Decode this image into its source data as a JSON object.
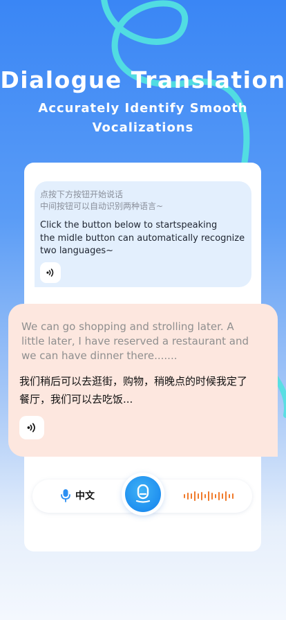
{
  "hero": {
    "title": "Dialogue Translation",
    "subtitle": "Accurately Identify Smooth Vocalizations"
  },
  "source_bubble": {
    "hint_line1": "点按下方按钮开始说话",
    "hint_line2": "中间按钮可以自动识别两种语言~",
    "text_line1": "Click the button below to startspeaking",
    "text_line2": "the midle button can automatically recognize",
    "text_line3": "two languages~",
    "speaker_icon": "speaker-icon"
  },
  "translation_bubble": {
    "en_line1": "We can go shopping and strolling later. A",
    "en_line2": "little later, I have reserved a restaurant and",
    "en_line3": "we can have dinner there.......",
    "zh_line1": "我们稍后可以去逛街，购物，稍晚点的时候我定了",
    "zh_line2": "餐厅，我们可以去吃饭...",
    "speaker_icon": "speaker-icon"
  },
  "controls": {
    "language_label": "中文",
    "language_icon": "microphone-icon",
    "record_icon": "microphone-icon",
    "wave_icon": "sound-wave-icon"
  },
  "colors": {
    "background_top": "#3a86f5",
    "accent_blue": "#1f8ff0",
    "accent_orange": "#f07a2a",
    "source_bubble": "#e3effd",
    "translation_bubble": "#fde7df"
  }
}
